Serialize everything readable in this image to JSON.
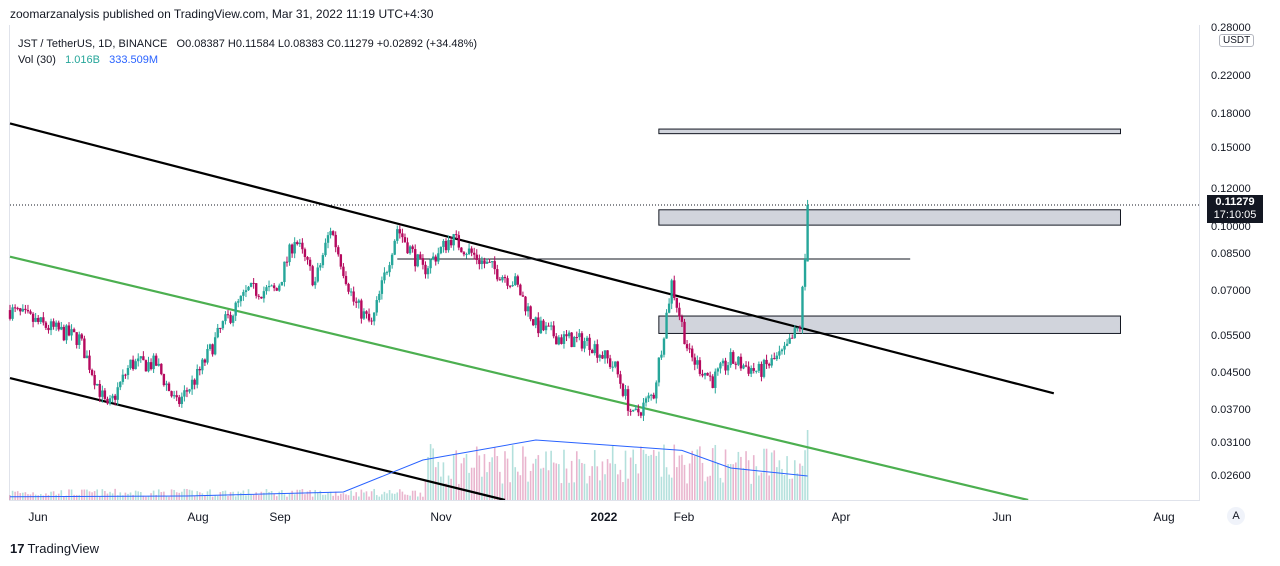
{
  "header": {
    "publisher_text": "zoomarzanalysis published on TradingView.com, Mar 31, 2022 11:19 UTC+4:30"
  },
  "legend": {
    "symbol_line": "JST / TetherUS, 1D, BINANCE",
    "ohlc": "O0.08387  H0.11584  L0.08383  C0.11279  +0.02892 (+34.48%)",
    "volume_label": "Vol (30)",
    "volume_value": "1.016B",
    "volume_ma": "333.509M"
  },
  "price_axis": {
    "currency": "USDT",
    "ticks": [
      "0.28000",
      "0.22000",
      "0.18000",
      "0.15000",
      "0.12000",
      "0.10000",
      "0.08500",
      "0.07000",
      "0.05500",
      "0.04500",
      "0.03700",
      "0.03100",
      "0.02600"
    ],
    "last_price": "0.11279",
    "countdown": "17:10:05"
  },
  "time_axis": {
    "ticks": [
      "Jun",
      "Aug",
      "Sep",
      "Nov",
      "2022",
      "Feb",
      "Apr",
      "Jun",
      "Aug"
    ],
    "auto_label": "A"
  },
  "footer": {
    "brand_logo": "17",
    "brand": "TradingView"
  },
  "chart_data": {
    "type": "candlestick",
    "symbol": "JST / TetherUS",
    "interval": "1D",
    "exchange": "BINANCE",
    "y_scale": "log",
    "ylim": [
      0.024,
      0.29
    ],
    "xlim": [
      "2021-05-24",
      "2022-08-31"
    ],
    "colors": {
      "up": "#26a69a",
      "down": "#b5095e",
      "trendline": "#000000",
      "channel_mid": "#4caf50",
      "volume_ma": "#2962ff",
      "zone_fill": "#d1d4dc"
    },
    "last_candle": {
      "date": "2022-03-31",
      "open": 0.08387,
      "high": 0.11584,
      "low": 0.08383,
      "close": 0.11279
    },
    "price_path": [
      [
        "2021-05-24",
        0.065
      ],
      [
        "2021-06-06",
        0.06
      ],
      [
        "2021-06-20",
        0.056
      ],
      [
        "2021-07-01",
        0.0385
      ],
      [
        "2021-07-10",
        0.049
      ],
      [
        "2021-07-20",
        0.049
      ],
      [
        "2021-07-28",
        0.0395
      ],
      [
        "2021-08-05",
        0.046
      ],
      [
        "2021-08-15",
        0.06
      ],
      [
        "2021-08-25",
        0.072
      ],
      [
        "2021-09-05",
        0.072
      ],
      [
        "2021-09-12",
        0.095
      ],
      [
        "2021-09-20",
        0.075
      ],
      [
        "2021-09-26",
        0.1
      ],
      [
        "2021-10-05",
        0.068
      ],
      [
        "2021-10-12",
        0.06
      ],
      [
        "2021-10-22",
        0.1
      ],
      [
        "2021-11-01",
        0.08
      ],
      [
        "2021-11-12",
        0.095
      ],
      [
        "2021-11-25",
        0.083
      ],
      [
        "2021-12-07",
        0.075
      ],
      [
        "2021-12-15",
        0.06
      ],
      [
        "2021-12-25",
        0.056
      ],
      [
        "2022-01-05",
        0.055
      ],
      [
        "2022-01-15",
        0.048
      ],
      [
        "2022-01-22",
        0.037
      ],
      [
        "2022-01-30",
        0.042
      ],
      [
        "2022-02-06",
        0.075
      ],
      [
        "2022-02-13",
        0.051
      ],
      [
        "2022-02-22",
        0.045
      ],
      [
        "2022-03-01",
        0.05
      ],
      [
        "2022-03-12",
        0.047
      ],
      [
        "2022-03-22",
        0.052
      ],
      [
        "2022-03-28",
        0.06
      ],
      [
        "2022-03-30",
        0.085
      ],
      [
        "2022-03-31",
        0.11279
      ]
    ],
    "volume_ma_path": [
      [
        "2021-05-24",
        0.04
      ],
      [
        "2021-08-01",
        0.05
      ],
      [
        "2021-10-01",
        0.1
      ],
      [
        "2021-11-01",
        0.5
      ],
      [
        "2021-12-15",
        0.75
      ],
      [
        "2022-01-15",
        0.68
      ],
      [
        "2022-02-10",
        0.62
      ],
      [
        "2022-03-01",
        0.4
      ],
      [
        "2022-03-31",
        0.3
      ]
    ],
    "annotations": {
      "horizontal_line": {
        "price": 0.085,
        "from": "2021-10-22",
        "to": "2022-05-10"
      },
      "zones": [
        {
          "from": "2022-02-01",
          "to": "2022-07-31",
          "low": 0.0575,
          "high": 0.063
        },
        {
          "from": "2022-02-01",
          "to": "2022-07-31",
          "low": 0.1015,
          "high": 0.11
        },
        {
          "from": "2022-02-01",
          "to": "2022-07-31",
          "low": 0.164,
          "high": 0.168
        }
      ],
      "trendlines": [
        {
          "name": "upper",
          "from": [
            "2021-05-24",
            0.173
          ],
          "to": [
            "2022-07-05",
            0.042
          ]
        },
        {
          "name": "lower",
          "from": [
            "2021-05-24",
            0.0455
          ],
          "to": [
            "2021-12-03",
            0.024
          ]
        },
        {
          "name": "middle",
          "from": [
            "2021-05-24",
            0.086
          ],
          "to": [
            "2022-06-25",
            0.024
          ]
        }
      ],
      "last_price_line": 0.11279
    }
  }
}
